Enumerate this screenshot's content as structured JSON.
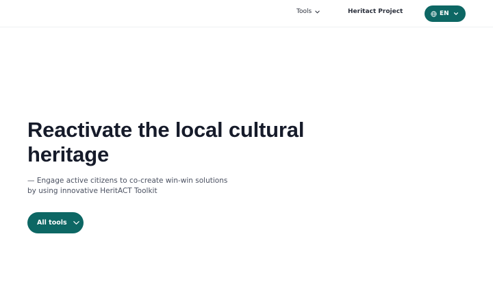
{
  "header": {
    "tools_label": "Tools",
    "project_label": "Heritact Project",
    "language": {
      "label": "EN",
      "icon": "globe-icon"
    }
  },
  "hero": {
    "title": "Reactivate the local cultural heritage",
    "subtitle": "— Engage active citizens to co-create win-win solutions by using innovative HeritACT Toolkit",
    "cta_label": "All tools"
  },
  "colors": {
    "accent": "#0d6764",
    "heading": "#161b2a",
    "body_text": "#4a5060",
    "background": "#ffffff"
  }
}
